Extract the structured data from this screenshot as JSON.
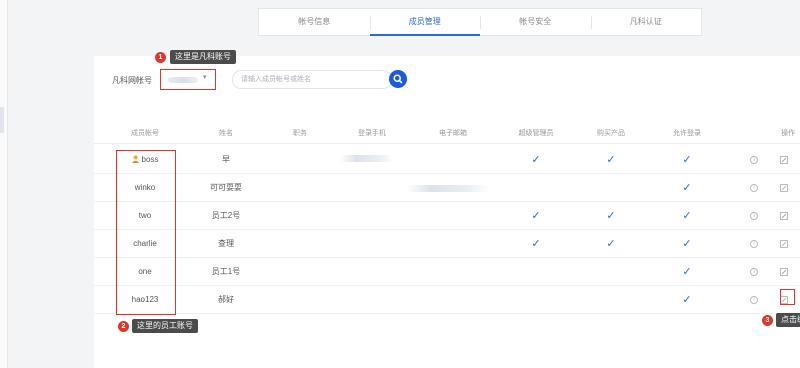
{
  "tabs": [
    {
      "label": "帐号信息",
      "active": false
    },
    {
      "label": "成员管理",
      "active": true
    },
    {
      "label": "帐号安全",
      "active": false
    },
    {
      "label": "凡科认证",
      "active": false
    }
  ],
  "account": {
    "label": "凡科网帐号",
    "callout_number": "1",
    "callout_text": "这里是凡科账号"
  },
  "search": {
    "placeholder": "请输入成员帐号或姓名"
  },
  "table": {
    "headers": [
      "成员帐号",
      "姓名",
      "职务",
      "登录手机",
      "电子邮箱",
      "超级管理员",
      "购买产品",
      "允许登录",
      "操作"
    ],
    "rows": [
      {
        "account": "boss",
        "name": "早",
        "owner": true,
        "super_admin": true,
        "buy_product": true,
        "allow_login": true
      },
      {
        "account": "winko",
        "name": "可可耍耍",
        "owner": false,
        "super_admin": false,
        "buy_product": false,
        "allow_login": true
      },
      {
        "account": "two",
        "name": "员工2号",
        "owner": false,
        "super_admin": true,
        "buy_product": true,
        "allow_login": true
      },
      {
        "account": "charlie",
        "name": "查理",
        "owner": false,
        "super_admin": true,
        "buy_product": true,
        "allow_login": true
      },
      {
        "account": "one",
        "name": "员工1号",
        "owner": false,
        "super_admin": false,
        "buy_product": false,
        "allow_login": true
      },
      {
        "account": "hao123",
        "name": "郝好",
        "owner": false,
        "super_admin": false,
        "buy_product": false,
        "allow_login": true
      }
    ]
  },
  "annotations": {
    "members": {
      "number": "2",
      "text": "这里的员工账号"
    },
    "edit": {
      "number": "3",
      "text": "点击编"
    }
  },
  "colors": {
    "accent": "#2b6bd6",
    "highlight": "#e0352b",
    "callout_bg": "#4b4b4b"
  },
  "icons": {
    "check": "✓",
    "info": "i",
    "caret": "▾"
  }
}
